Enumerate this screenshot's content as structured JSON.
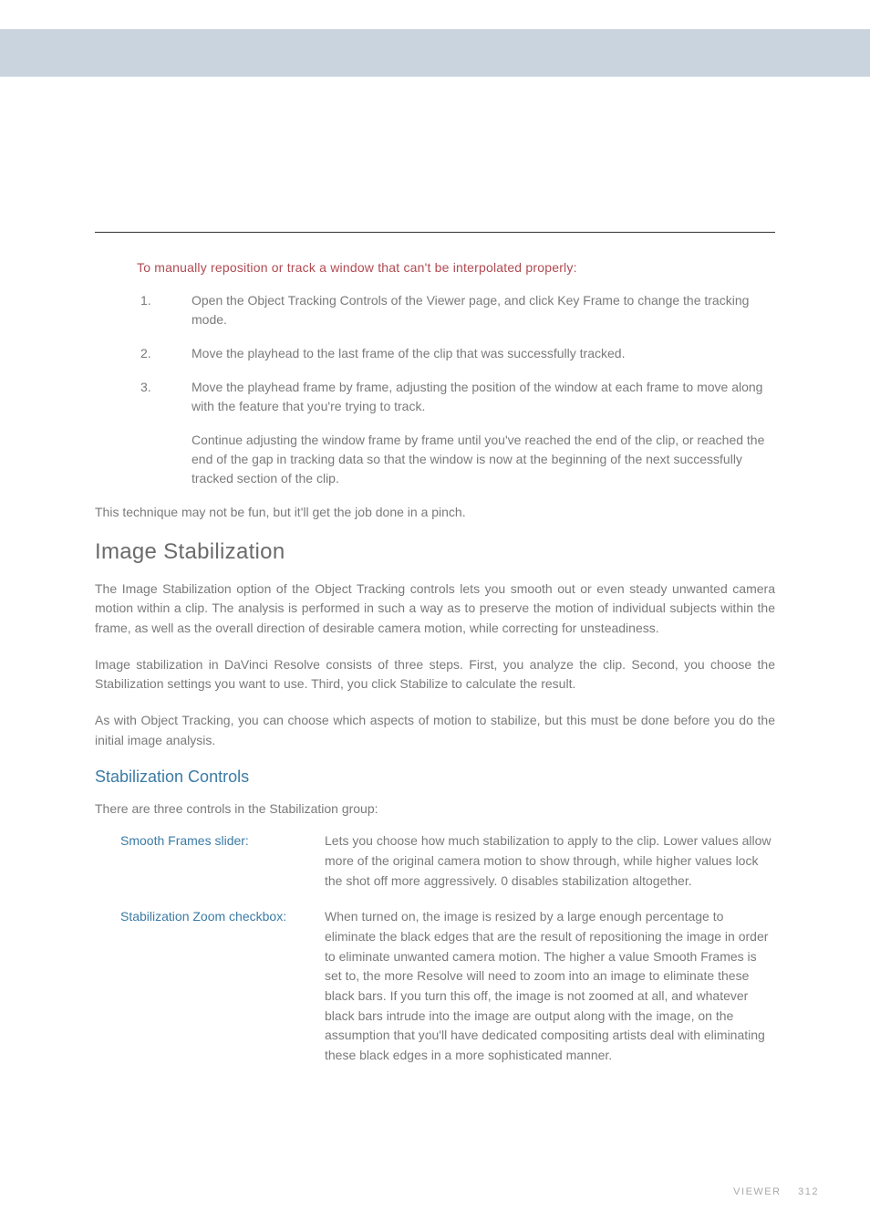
{
  "proc_heading": "To manually reposition or track a window that can't be interpolated properly:",
  "steps": [
    {
      "n": "1.",
      "t": "Open the Object Tracking Controls of the Viewer page, and click Key Frame to change the tracking mode."
    },
    {
      "n": "2.",
      "t": "Move the playhead to the last frame of the clip that was successfully tracked."
    },
    {
      "n": "3.",
      "t": "Move the playhead frame by frame, adjusting the position of the window at each frame to move along with the feature that you're trying to track."
    }
  ],
  "step_cont": "Continue adjusting the window frame by frame until you've reached the end of the clip, or reached the end of the gap in tracking data so that the window is now at the beginning of the next successfully tracked section of the clip.",
  "p_after_steps": "This technique may not be fun, but it'll get the job done in a pinch.",
  "h2": "Image Stabilization",
  "is_p1": "The Image Stabilization option of the Object Tracking controls lets you smooth out or even steady unwanted camera motion within a clip. The analysis is performed in such a way as to preserve the motion of individual subjects within the frame, as well as the overall direction of desirable camera motion, while correcting for unsteadiness.",
  "is_p2": "Image stabilization in DaVinci Resolve consists of three steps. First, you analyze the clip. Second, you choose the Stabilization settings you want to use. Third, you click Stabilize to calculate the result.",
  "is_p3": "As with Object Tracking, you can choose which aspects of motion to stabilize, but this must be done before you do the initial image analysis.",
  "h3": "Stabilization Controls",
  "sc_intro": "There are three controls in the Stabilization group:",
  "defs": [
    {
      "term": "Smooth Frames slider:",
      "body": "Lets you choose how much stabilization to apply to the clip. Lower values allow more of the original camera motion to show through, while higher values lock the shot off more aggressively. 0 disables stabilization altogether."
    },
    {
      "term": "Stabilization Zoom checkbox:",
      "body": "When turned on, the image is resized by a large enough percentage to eliminate the black edges that are the result of repositioning the image in order to eliminate unwanted camera motion. The higher a value Smooth Frames is set to, the more Resolve will need to zoom into an image to eliminate these black bars. If you turn this off, the image is not zoomed at all, and whatever black bars intrude into the image are output along with the image, on the assumption that you'll have dedicated compositing artists deal with eliminating these black edges in a more sophisticated manner."
    }
  ],
  "footer_section": "VIEWER",
  "footer_page": "312"
}
